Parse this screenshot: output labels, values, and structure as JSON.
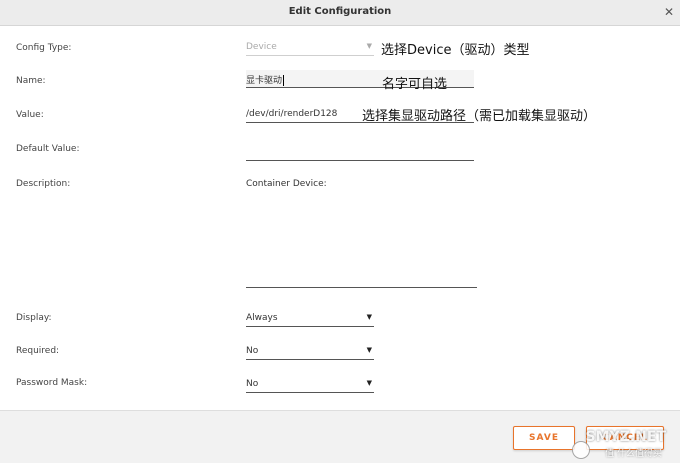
{
  "window": {
    "title": "Edit Configuration",
    "close_glyph": "✕"
  },
  "form": {
    "config_type": {
      "label": "Config Type:",
      "value": "Device",
      "disabled": true
    },
    "name": {
      "label": "Name:",
      "value": "显卡驱动"
    },
    "value": {
      "label": "Value:",
      "value": "/dev/dri/renderD128"
    },
    "default_value": {
      "label": "Default Value:",
      "value": ""
    },
    "description": {
      "label": "Description:",
      "value": "Container Device:"
    },
    "display": {
      "label": "Display:",
      "value": "Always"
    },
    "required": {
      "label": "Required:",
      "value": "No"
    },
    "password_mask": {
      "label": "Password Mask:",
      "value": "No"
    }
  },
  "annotations": {
    "config_type": "选择Device（驱动）类型",
    "name": "名字可自选",
    "value": "选择集显驱动路径（需已加载集显驱动）"
  },
  "footer": {
    "save_label": "SAVE",
    "cancel_label": "CANCEL"
  },
  "watermark": {
    "text": "SMYZ.NET",
    "sub": "值 什么值得买"
  },
  "colors": {
    "accent": "#e8742b",
    "titlebar_bg": "#ececec",
    "footer_bg": "#f2f2f2"
  },
  "icons": {
    "dropdown": "chevron-down-icon",
    "close": "close-icon"
  }
}
